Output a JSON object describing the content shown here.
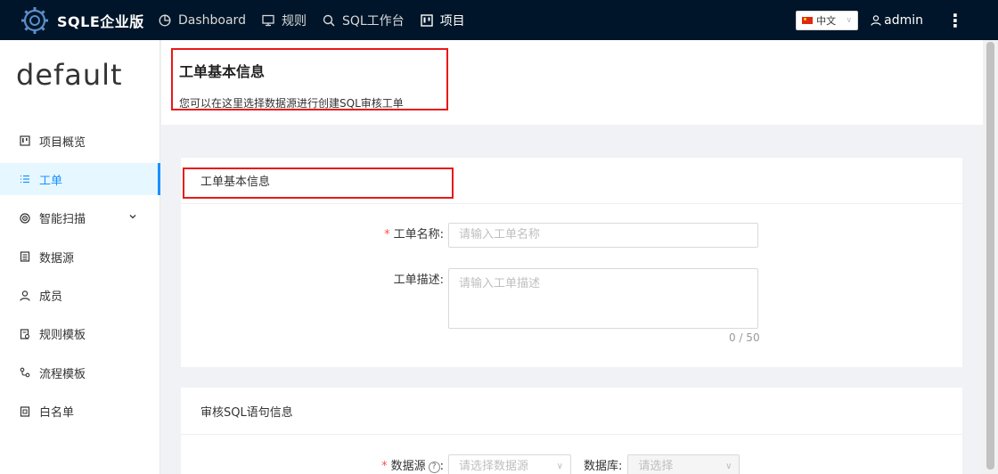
{
  "header": {
    "logo_text": "SQLE企业版",
    "nav": [
      {
        "label": "Dashboard",
        "icon": "dashboard-icon"
      },
      {
        "label": "规则",
        "icon": "monitor-icon"
      },
      {
        "label": "SQL工作台",
        "icon": "search-icon"
      },
      {
        "label": "项目",
        "icon": "project-icon"
      }
    ],
    "language": "中文",
    "user": "admin"
  },
  "sidebar": {
    "project_name": "default",
    "items": [
      {
        "label": "项目概览",
        "icon": "overview-icon"
      },
      {
        "label": "工单",
        "icon": "list-icon"
      },
      {
        "label": "智能扫描",
        "icon": "scan-icon"
      },
      {
        "label": "数据源",
        "icon": "datasource-icon"
      },
      {
        "label": "成员",
        "icon": "user-icon"
      },
      {
        "label": "规则模板",
        "icon": "rule-template-icon"
      },
      {
        "label": "流程模板",
        "icon": "workflow-icon"
      },
      {
        "label": "白名单",
        "icon": "whitelist-icon"
      }
    ],
    "active_index": 1
  },
  "page": {
    "title": "工单基本信息",
    "description": "您可以在这里选择数据源进行创建SQL审核工单"
  },
  "basic_card": {
    "title": "工单基本信息",
    "name_label": "工单名称:",
    "name_placeholder": "请输入工单名称",
    "desc_label": "工单描述:",
    "desc_placeholder": "请输入工单描述",
    "counter": "0 / 50"
  },
  "sql_card": {
    "title": "审核SQL语句信息",
    "datasource_label": "数据源",
    "datasource_placeholder": "请选择数据源",
    "database_label": "数据库:",
    "database_placeholder": "请选择"
  },
  "colors": {
    "header_bg": "#001529",
    "accent": "#1890ff",
    "annotation": "#e81919",
    "required": "#ff4d4f"
  }
}
